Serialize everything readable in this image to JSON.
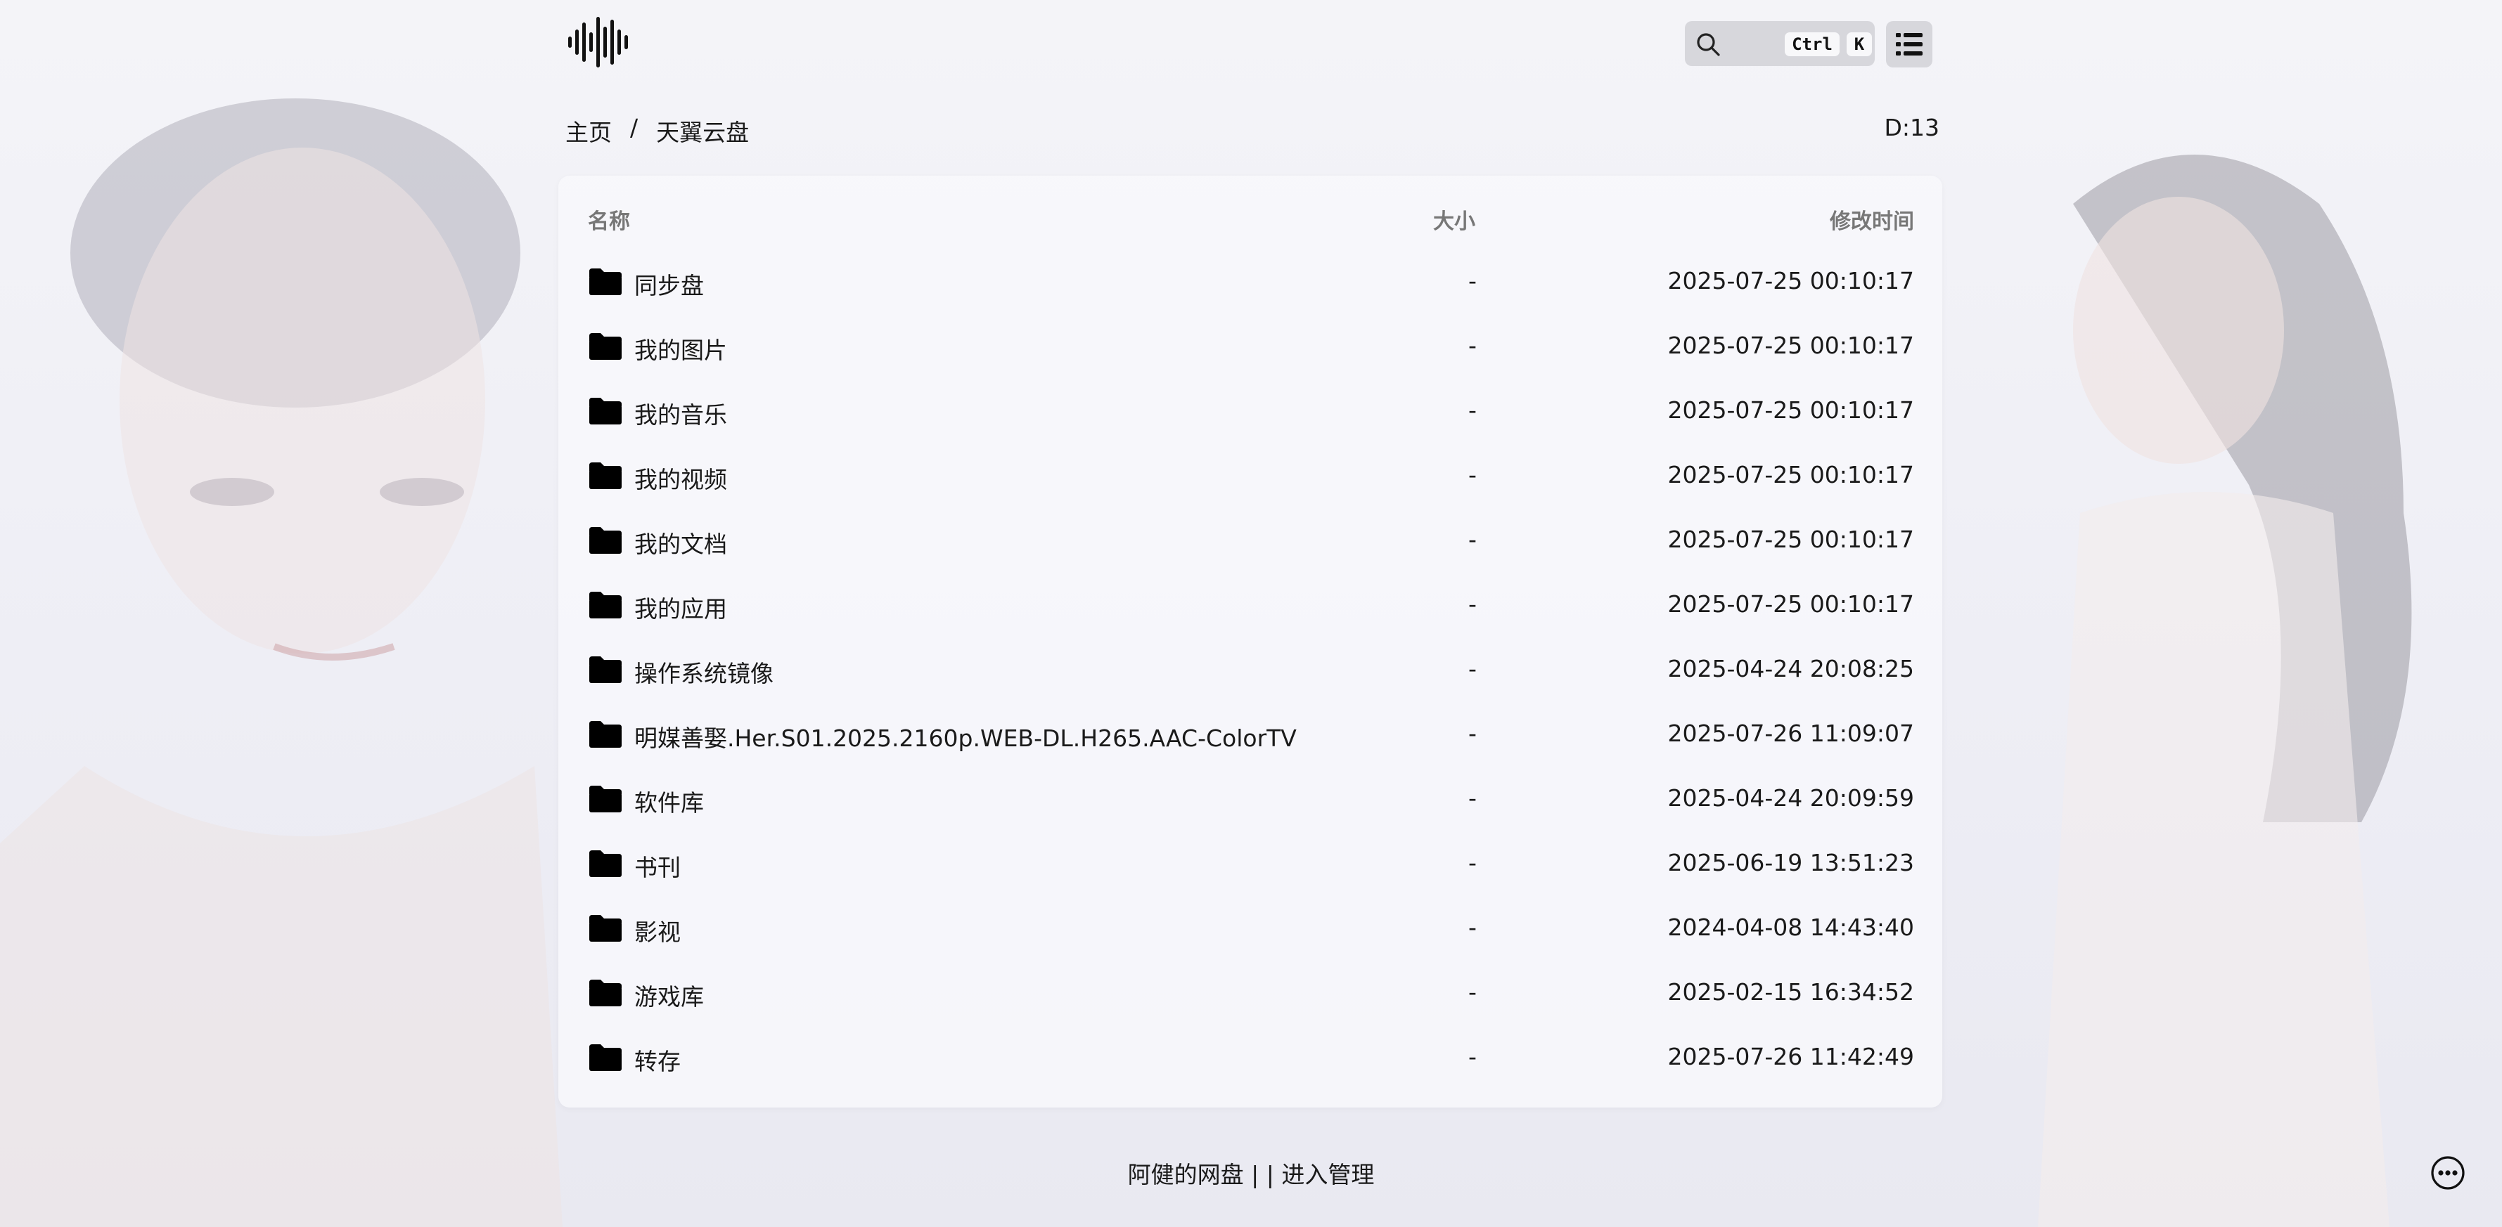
{
  "search": {
    "placeholder": "",
    "kbd_ctrl": "Ctrl",
    "kbd_k": "K"
  },
  "breadcrumb": {
    "home": "主页",
    "separator": "/",
    "current": "天翼云盘"
  },
  "dir_count": "D:13",
  "table": {
    "headers": {
      "name": "名称",
      "size": "大小",
      "modified": "修改时间"
    },
    "rows": [
      {
        "name": "同步盘",
        "size": "-",
        "modified": "2025-07-25 00:10:17"
      },
      {
        "name": "我的图片",
        "size": "-",
        "modified": "2025-07-25 00:10:17"
      },
      {
        "name": "我的音乐",
        "size": "-",
        "modified": "2025-07-25 00:10:17"
      },
      {
        "name": "我的视频",
        "size": "-",
        "modified": "2025-07-25 00:10:17"
      },
      {
        "name": "我的文档",
        "size": "-",
        "modified": "2025-07-25 00:10:17"
      },
      {
        "name": "我的应用",
        "size": "-",
        "modified": "2025-07-25 00:10:17"
      },
      {
        "name": "操作系统镜像",
        "size": "-",
        "modified": "2025-04-24 20:08:25"
      },
      {
        "name": "明媒善娶.Her.S01.2025.2160p.WEB-DL.H265.AAC-ColorTV",
        "size": "-",
        "modified": "2025-07-26 11:09:07"
      },
      {
        "name": "软件库",
        "size": "-",
        "modified": "2025-04-24 20:09:59"
      },
      {
        "name": "书刊",
        "size": "-",
        "modified": "2025-06-19 13:51:23"
      },
      {
        "name": "影视",
        "size": "-",
        "modified": "2024-04-08 14:43:40"
      },
      {
        "name": "游戏库",
        "size": "-",
        "modified": "2025-02-15 16:34:52"
      },
      {
        "name": "转存",
        "size": "-",
        "modified": "2025-07-26 11:42:49"
      }
    ]
  },
  "footer": {
    "site_name": "阿健的网盘",
    "divider": "| |",
    "admin_link": "进入管理"
  },
  "icons": {
    "logo": "sound-wave-icon",
    "search": "search-icon",
    "menu": "list-icon",
    "folder": "folder-icon",
    "more": "ellipsis-circle-icon"
  }
}
